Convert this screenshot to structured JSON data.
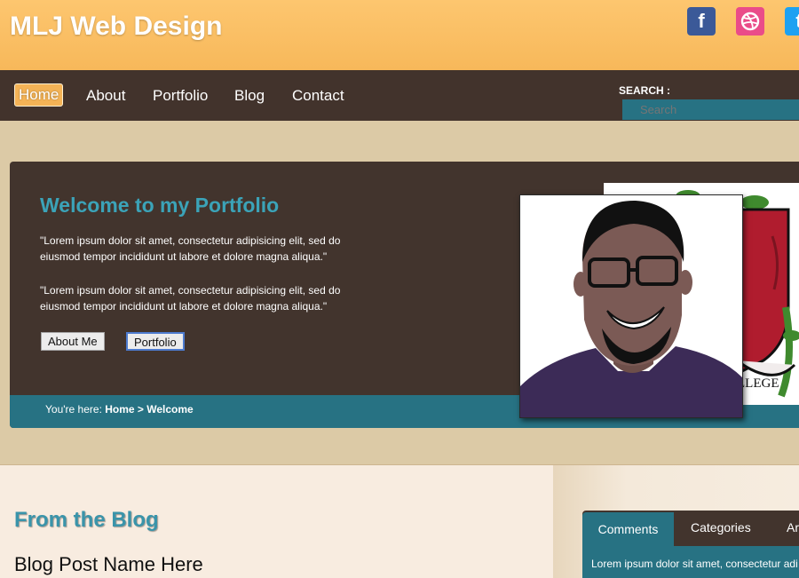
{
  "header": {
    "site_title": "MLJ Web Design",
    "social": [
      {
        "icon": "facebook-icon",
        "glyph": "f"
      },
      {
        "icon": "dribbble-icon",
        "glyph": "◎"
      },
      {
        "icon": "twitter-icon",
        "glyph": "t"
      }
    ]
  },
  "nav": {
    "items": [
      {
        "label": "Home",
        "active": true
      },
      {
        "label": "About"
      },
      {
        "label": "Portfolio"
      },
      {
        "label": "Blog"
      },
      {
        "label": "Contact"
      }
    ],
    "search_label": "SEARCH :",
    "search_placeholder": "Search"
  },
  "hero": {
    "title": "Welcome to my Portfolio",
    "paragraph1": "\"Lorem ipsum dolor sit amet, consectetur adipisicing elit, sed do eiusmod tempor incididunt ut labore et dolore magna aliqua.\"",
    "paragraph2": "\"Lorem ipsum dolor sit amet, consectetur adipisicing elit, sed do eiusmod tempor incididunt ut labore et dolore magna aliqua.\"",
    "about_button": "About Me",
    "portfolio_button": "Portfolio",
    "breadcrumb_prefix": "You're here:",
    "breadcrumb_path": "Home > Welcome"
  },
  "blog": {
    "heading": "From the Blog",
    "post_name": "Blog Post Name Here"
  },
  "sidebar": {
    "tabs": [
      "Comments",
      "Categories",
      "Ar"
    ],
    "panel_text": "Lorem ipsum dolor sit amet, consectetur adi"
  },
  "colors": {
    "header": "#f7b85a",
    "nav": "#42332c",
    "accent_teal": "#277283",
    "title_teal": "#3ba3b8",
    "background": "#dccaa6"
  }
}
